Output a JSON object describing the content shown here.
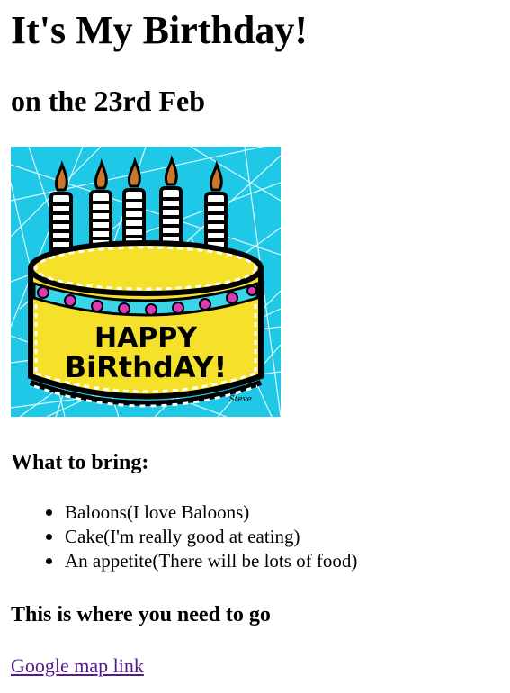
{
  "header": {
    "title": "It's My Birthday!",
    "subtitle": "on the 23rd Feb"
  },
  "image": {
    "icon": "birthday-cake-image",
    "cake_text_line1": "HAPPY",
    "cake_text_line2": "BiRthdAY!",
    "signature": "Steve",
    "colors": {
      "background": "#1ec8e6",
      "cake": "#f6e12a",
      "candle_flame": "#c8772e",
      "trim_pink": "#d93bb5",
      "trim_cyan": "#3ad6e8"
    }
  },
  "bring": {
    "heading": "What to bring:",
    "items": [
      "Baloons(I love Baloons)",
      "Cake(I'm really good at eating)",
      "An appetite(There will be lots of food)"
    ]
  },
  "directions": {
    "heading": "This is where you need to go",
    "link_text": "Google map link",
    "link_color": "#551a8b"
  }
}
